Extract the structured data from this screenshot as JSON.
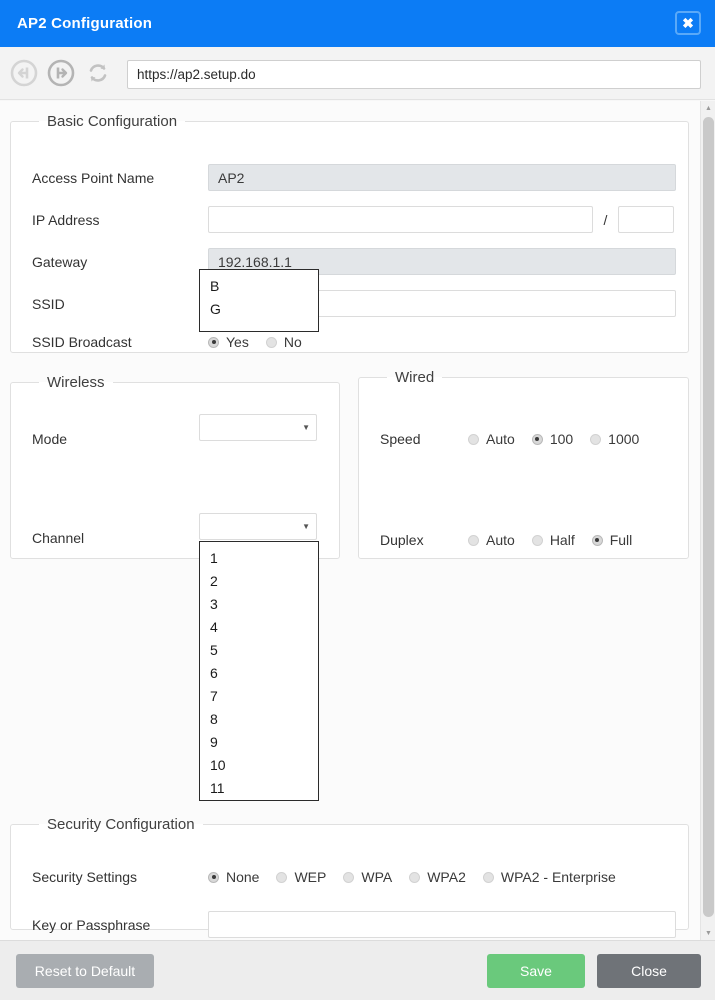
{
  "window": {
    "title": "AP2 Configuration",
    "close_icon": "close-icon",
    "close_glyph": "✖"
  },
  "browser": {
    "back_icon": "back-arrow-icon",
    "forward_icon": "forward-arrow-icon",
    "reload_icon": "reload-icon",
    "url": "https://ap2.setup.do"
  },
  "basic": {
    "legend": "Basic Configuration",
    "access_point_name": {
      "label": "Access Point Name",
      "value": "AP2",
      "disabled": true
    },
    "ip_address": {
      "label": "IP Address",
      "value": "",
      "separator": "/",
      "prefix_value": ""
    },
    "gateway": {
      "label": "Gateway",
      "value": "192.168.1.1",
      "disabled": true
    },
    "ssid": {
      "label": "SSID",
      "value": ""
    },
    "ssid_broadcast": {
      "label": "SSID Broadcast",
      "options": [
        "Yes",
        "No"
      ],
      "selected": "Yes"
    }
  },
  "wireless": {
    "legend": "Wireless",
    "mode": {
      "label": "Mode",
      "value": "",
      "expanded": true,
      "options": [
        "B",
        "G"
      ]
    },
    "channel": {
      "label": "Channel",
      "value": "",
      "expanded": true,
      "options": [
        "1",
        "2",
        "3",
        "4",
        "5",
        "6",
        "7",
        "8",
        "9",
        "10",
        "11"
      ]
    }
  },
  "wired": {
    "legend": "Wired",
    "speed": {
      "label": "Speed",
      "options": [
        "Auto",
        "100",
        "1000"
      ],
      "selected": "100"
    },
    "duplex": {
      "label": "Duplex",
      "options": [
        "Auto",
        "Half",
        "Full"
      ],
      "selected": "Full"
    }
  },
  "security": {
    "legend": "Security Configuration",
    "settings": {
      "label": "Security Settings",
      "options": [
        "None",
        "WEP",
        "WPA",
        "WPA2",
        "WPA2 - Enterprise"
      ],
      "selected": "None"
    },
    "key": {
      "label": "Key or Passphrase",
      "value": ""
    }
  },
  "footer": {
    "reset_label": "Reset to Default",
    "save_label": "Save",
    "close_label": "Close"
  },
  "scrollbar": {
    "up_glyph": "▲",
    "down_glyph": "▼"
  },
  "colors": {
    "titlebar": "#0c7cf5",
    "save": "#6ac97c",
    "close": "#6f7378",
    "reset": "#a9adb1"
  }
}
